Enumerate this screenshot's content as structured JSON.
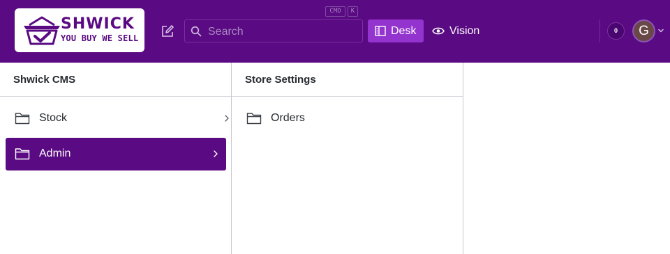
{
  "brand": {
    "name": "SHWICK",
    "tagline": "YOU BUY WE SELL",
    "color": "#5a0a82"
  },
  "search": {
    "placeholder": "Search",
    "shortcut_modifier": "CMD",
    "shortcut_key": "K"
  },
  "nav": {
    "desk_label": "Desk",
    "vision_label": "Vision"
  },
  "user": {
    "notification_count": "0",
    "avatar_initial": "G"
  },
  "panes": [
    {
      "title": "Shwick CMS",
      "items": [
        {
          "label": "Stock",
          "selected": false
        },
        {
          "label": "Admin",
          "selected": true
        }
      ]
    },
    {
      "title": "Store Settings",
      "items": [
        {
          "label": "Orders",
          "selected": false
        }
      ]
    }
  ],
  "colors": {
    "header_bg": "#5a0a82",
    "active_tool_bg": "#9434cf",
    "selected_row_bg": "#5a0a82"
  }
}
